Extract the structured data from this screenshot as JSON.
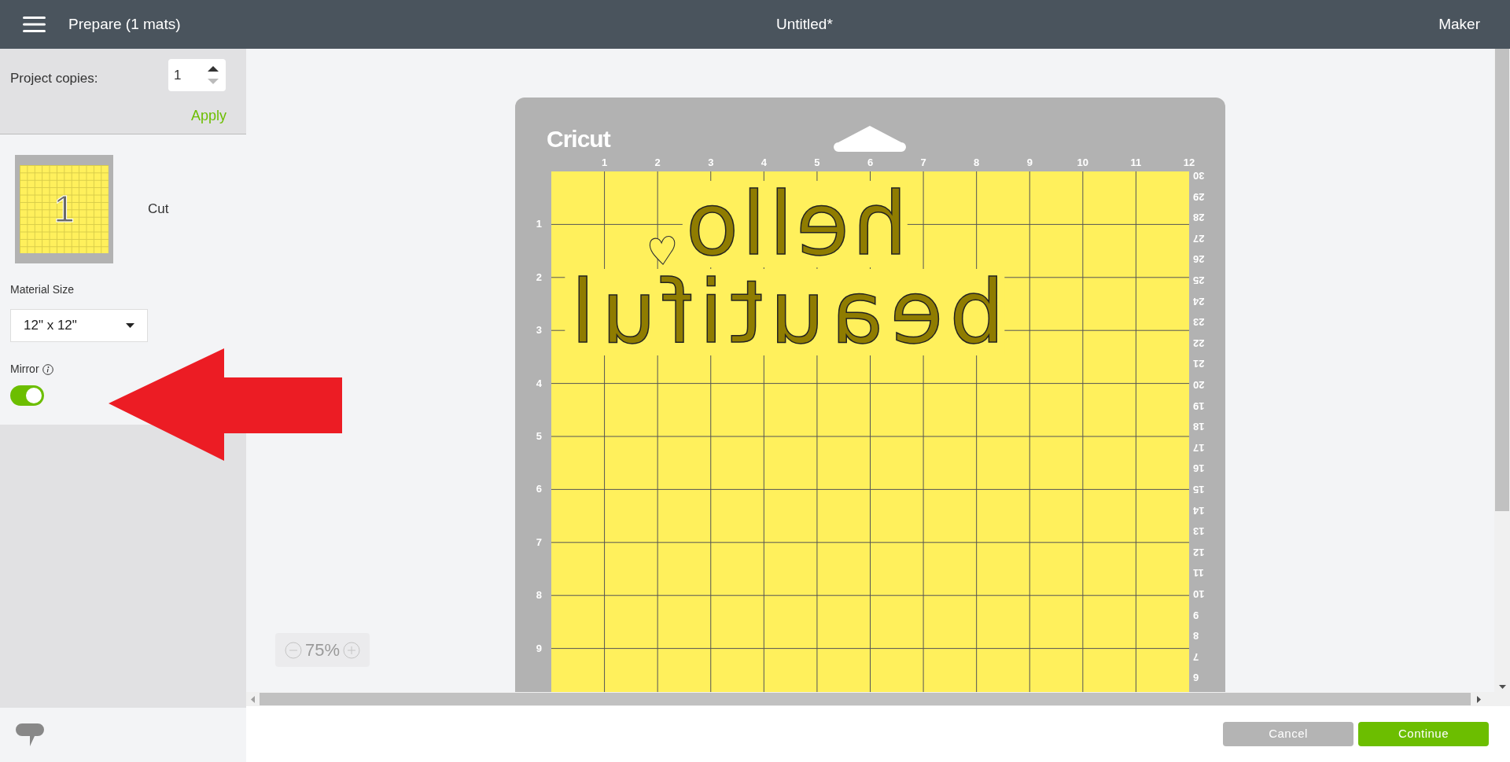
{
  "header": {
    "title": "Prepare (1 mats)",
    "document": "Untitled*",
    "machine": "Maker"
  },
  "sidebar": {
    "copies_label": "Project copies:",
    "copies_value": "1",
    "apply": "Apply",
    "mats": [
      {
        "number": "1",
        "label": "Cut"
      }
    ],
    "material_size_label": "Material Size",
    "material_size": "12\" x 12\"",
    "mirror_label": "Mirror",
    "mirror_on": true
  },
  "mat": {
    "logo": "Cricut",
    "top_ruler": [
      "1",
      "2",
      "3",
      "4",
      "5",
      "6",
      "7",
      "8",
      "9",
      "10",
      "11",
      "12"
    ],
    "left_ruler": [
      "1",
      "2",
      "3",
      "4",
      "5",
      "6",
      "7",
      "8",
      "9"
    ],
    "right_ruler": [
      "30",
      "29",
      "28",
      "27",
      "26",
      "25",
      "24",
      "23",
      "22",
      "21",
      "20",
      "19",
      "18",
      "17",
      "16",
      "15",
      "14",
      "13",
      "12",
      "11",
      "10",
      "9",
      "8",
      "7",
      "6"
    ],
    "design": [
      "hello",
      "beautiful"
    ]
  },
  "zoom": "75%",
  "buttons": [
    {
      "label": "Cancel",
      "kind": "secondary"
    },
    {
      "label": "Continue",
      "kind": "primary"
    }
  ]
}
